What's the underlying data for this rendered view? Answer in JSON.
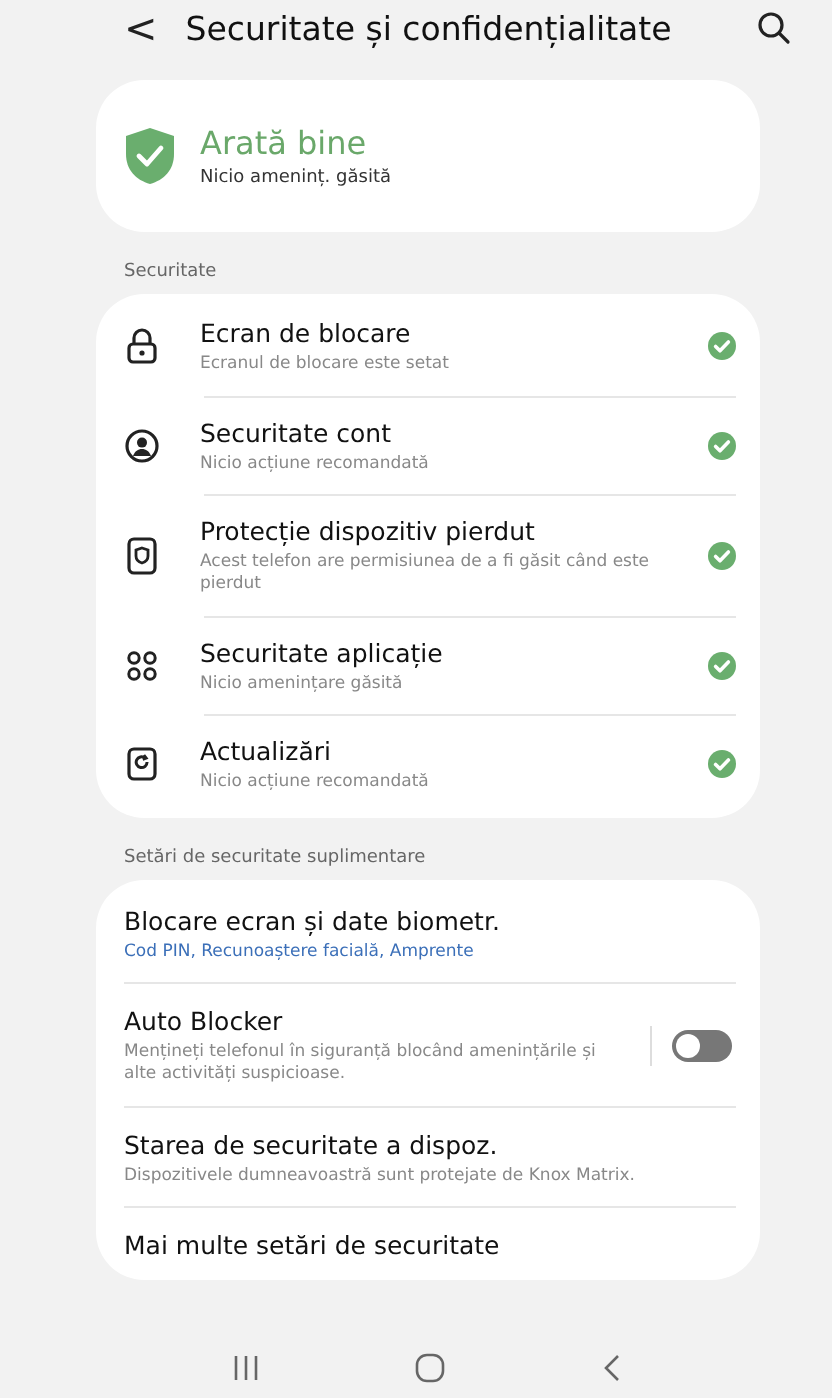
{
  "header": {
    "back": "<",
    "title": "Securitate și confidențialitate"
  },
  "status": {
    "title": "Arată bine",
    "subtitle": "Nicio ameninț. găsită",
    "ok": true
  },
  "security": {
    "label": "Securitate",
    "items": [
      {
        "kind": "lock",
        "title": "Ecran de blocare",
        "subtitle": "Ecranul de blocare este setat",
        "ok": true
      },
      {
        "kind": "account",
        "title": "Securitate cont",
        "subtitle": "Nicio acțiune recomandată",
        "ok": true
      },
      {
        "kind": "device",
        "title": "Protecție dispozitiv pierdut",
        "subtitle": "Acest telefon are permisiunea de a fi găsit când este pierdut",
        "ok": true
      },
      {
        "kind": "apps",
        "title": "Securitate aplicație",
        "subtitle": "Nicio amenințare găsită",
        "ok": true
      },
      {
        "kind": "update",
        "title": "Actualizări",
        "subtitle": "Nicio acțiune recomandată",
        "ok": true
      }
    ]
  },
  "extra": {
    "label": "Setări de securitate suplimentare",
    "items": [
      {
        "kind": "link",
        "title": "Blocare ecran și date biometr.",
        "subtitle": "Cod PIN, Recunoaștere facială, Amprente"
      },
      {
        "kind": "toggle",
        "title": "Auto Blocker",
        "subtitle": "Mențineți telefonul în siguranță blocând amenințările și alte activități suspicioase.",
        "on": false
      },
      {
        "kind": "info",
        "title": "Starea de securitate a dispoz.",
        "subtitle": "Dispozitivele dumneavoastră sunt protejate de Knox Matrix."
      },
      {
        "kind": "plain",
        "title": "Mai multe setări de securitate"
      }
    ]
  }
}
